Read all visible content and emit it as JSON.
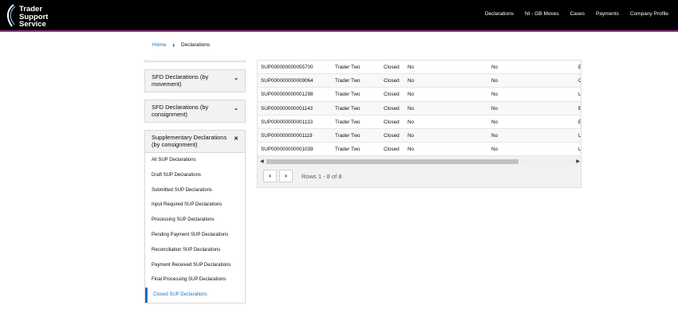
{
  "header": {
    "logo_lines": [
      "Trader",
      "Support",
      "Service"
    ],
    "nav": [
      "Declarations",
      "NI - GB Moves",
      "Cases",
      "Payments",
      "Company Profile"
    ]
  },
  "breadcrumb": {
    "home": "Home",
    "current": "Declarations"
  },
  "sidebar": {
    "sections": [
      {
        "title": "SFD Declarations (by movement)",
        "icon": "chevron-down-icon"
      },
      {
        "title": "SFD Declarations (by consignment)",
        "icon": "chevron-down-icon"
      },
      {
        "title": "Supplementary Declarations (by consignment)",
        "icon": "close-icon",
        "items": [
          "All SUP Declarations",
          "Draft SUP Declarations",
          "Submitted SUP Declarations",
          "Input Required SUP Declarations",
          "Processing SUP Declarations",
          "Pending Payment SUP Declarations",
          "Reconciliation SUP Declarations",
          "Payment Received SUP Declarations",
          "Final Processing SUP Declarations",
          "Closed SUP Declarations"
        ],
        "active_item": "Closed SUP Declarations"
      }
    ]
  },
  "table": {
    "rows": [
      [
        "SUP000000000055700",
        "Trader Two",
        "Closed",
        "No",
        "No",
        "E("
      ],
      [
        "SUP000000000009064",
        "Trader Two",
        "Closed",
        "No",
        "No",
        "C"
      ],
      [
        "SUP000000000001298",
        "Trader Two",
        "Closed",
        "No",
        "No",
        "LI"
      ],
      [
        "SUP000000000001143",
        "Trader Two",
        "Closed",
        "No",
        "No",
        "E("
      ],
      [
        "SUP000000000001133",
        "Trader Two",
        "Closed",
        "No",
        "No",
        "E("
      ],
      [
        "SUP000000000001119",
        "Trader Two",
        "Closed",
        "No",
        "No",
        "LI"
      ],
      [
        "SUP000000000001039",
        "Trader Two",
        "Closed",
        "No",
        "No",
        "LI"
      ]
    ]
  },
  "pagination": {
    "prev": "‹",
    "next": "›",
    "info": "Rows 1 - 8 of 8"
  }
}
